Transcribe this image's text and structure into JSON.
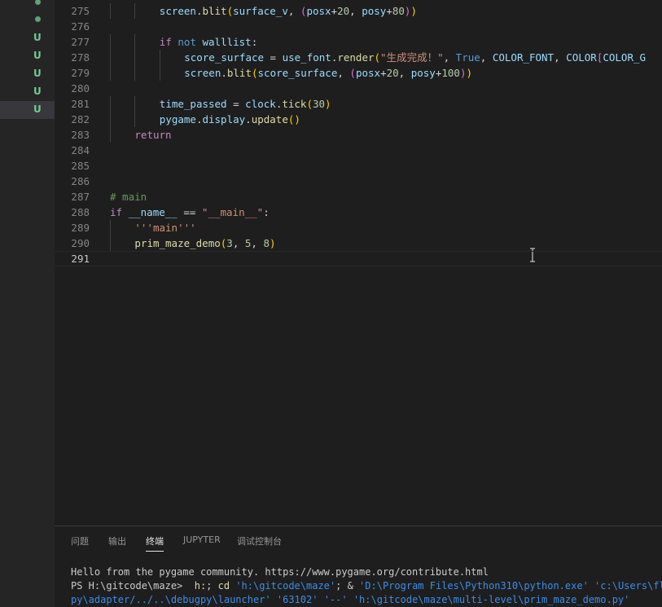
{
  "sidebar": {
    "git_markers": [
      {
        "type": "dot"
      },
      {
        "type": "dot"
      },
      {
        "type": "letter",
        "label": "U"
      },
      {
        "type": "letter",
        "label": "U"
      },
      {
        "type": "letter",
        "label": "U"
      },
      {
        "type": "letter",
        "label": "U"
      },
      {
        "type": "letter",
        "label": "U",
        "selected": true
      }
    ]
  },
  "editor": {
    "lines": [
      {
        "n": "275",
        "indent": 8,
        "tokens": [
          [
            "screen",
            "t-var"
          ],
          [
            ".",
            "t-op"
          ],
          [
            "blit",
            "t-fn"
          ],
          [
            "(",
            "t-br1"
          ],
          [
            "surface_v",
            "t-var"
          ],
          [
            ", ",
            "t-op"
          ],
          [
            "(",
            "t-br2"
          ],
          [
            "posx",
            "t-var"
          ],
          [
            "+",
            "t-op"
          ],
          [
            "20",
            "t-num"
          ],
          [
            ", ",
            "t-op"
          ],
          [
            "posy",
            "t-var"
          ],
          [
            "+",
            "t-op"
          ],
          [
            "80",
            "t-num"
          ],
          [
            ")",
            "t-br2"
          ],
          [
            ")",
            "t-br1"
          ]
        ]
      },
      {
        "n": "276",
        "indent": 0,
        "tokens": []
      },
      {
        "n": "277",
        "indent": 8,
        "tokens": [
          [
            "if",
            "t-kw"
          ],
          [
            " ",
            "t-op"
          ],
          [
            "not",
            "t-kb"
          ],
          [
            " ",
            "t-op"
          ],
          [
            "walllist",
            "t-var"
          ],
          [
            ":",
            "t-op"
          ]
        ]
      },
      {
        "n": "278",
        "indent": 12,
        "tokens": [
          [
            "score_surface",
            "t-var"
          ],
          [
            " = ",
            "t-op"
          ],
          [
            "use_font",
            "t-var"
          ],
          [
            ".",
            "t-op"
          ],
          [
            "render",
            "t-fn"
          ],
          [
            "(",
            "t-br1"
          ],
          [
            "\"生成完成！\"",
            "t-str"
          ],
          [
            ", ",
            "t-op"
          ],
          [
            "True",
            "t-kb"
          ],
          [
            ", ",
            "t-op"
          ],
          [
            "COLOR_FONT",
            "t-var"
          ],
          [
            ", ",
            "t-op"
          ],
          [
            "COLOR",
            "t-var"
          ],
          [
            "[",
            "t-br2"
          ],
          [
            "COLOR_G",
            "t-var"
          ]
        ]
      },
      {
        "n": "279",
        "indent": 12,
        "tokens": [
          [
            "screen",
            "t-var"
          ],
          [
            ".",
            "t-op"
          ],
          [
            "blit",
            "t-fn"
          ],
          [
            "(",
            "t-br1"
          ],
          [
            "score_surface",
            "t-var"
          ],
          [
            ", ",
            "t-op"
          ],
          [
            "(",
            "t-br2"
          ],
          [
            "posx",
            "t-var"
          ],
          [
            "+",
            "t-op"
          ],
          [
            "20",
            "t-num"
          ],
          [
            ", ",
            "t-op"
          ],
          [
            "posy",
            "t-var"
          ],
          [
            "+",
            "t-op"
          ],
          [
            "100",
            "t-num"
          ],
          [
            ")",
            "t-br2"
          ],
          [
            ")",
            "t-br1"
          ]
        ]
      },
      {
        "n": "280",
        "indent": 0,
        "tokens": []
      },
      {
        "n": "281",
        "indent": 8,
        "tokens": [
          [
            "time_passed",
            "t-var"
          ],
          [
            " = ",
            "t-op"
          ],
          [
            "clock",
            "t-var"
          ],
          [
            ".",
            "t-op"
          ],
          [
            "tick",
            "t-fn"
          ],
          [
            "(",
            "t-br1"
          ],
          [
            "30",
            "t-num"
          ],
          [
            ")",
            "t-br1"
          ]
        ]
      },
      {
        "n": "282",
        "indent": 8,
        "tokens": [
          [
            "pygame",
            "t-var"
          ],
          [
            ".",
            "t-op"
          ],
          [
            "display",
            "t-var"
          ],
          [
            ".",
            "t-op"
          ],
          [
            "update",
            "t-fn"
          ],
          [
            "()",
            "t-br1"
          ]
        ]
      },
      {
        "n": "283",
        "indent": 4,
        "tokens": [
          [
            "return",
            "t-kw"
          ]
        ]
      },
      {
        "n": "284",
        "indent": 0,
        "tokens": []
      },
      {
        "n": "285",
        "indent": 0,
        "tokens": []
      },
      {
        "n": "286",
        "indent": 0,
        "tokens": []
      },
      {
        "n": "287",
        "indent": 0,
        "tokens": [
          [
            "# main",
            "t-com"
          ]
        ]
      },
      {
        "n": "288",
        "indent": 0,
        "tokens": [
          [
            "if",
            "t-kw"
          ],
          [
            " ",
            "t-op"
          ],
          [
            "__name__",
            "t-var"
          ],
          [
            " == ",
            "t-op"
          ],
          [
            "\"__main__\"",
            "t-str"
          ],
          [
            ":",
            "t-op"
          ]
        ]
      },
      {
        "n": "289",
        "indent": 4,
        "tokens": [
          [
            "'''main'''",
            "t-str"
          ]
        ]
      },
      {
        "n": "290",
        "indent": 4,
        "tokens": [
          [
            "prim_maze_demo",
            "t-fn"
          ],
          [
            "(",
            "t-br1"
          ],
          [
            "3",
            "t-num"
          ],
          [
            ", ",
            "t-op"
          ],
          [
            "5",
            "t-num"
          ],
          [
            ", ",
            "t-op"
          ],
          [
            "8",
            "t-num"
          ],
          [
            ")",
            "t-br1"
          ]
        ]
      },
      {
        "n": "291",
        "indent": 0,
        "tokens": [],
        "current": true
      }
    ]
  },
  "panel": {
    "tabs": [
      {
        "label": "问题",
        "active": false
      },
      {
        "label": "输出",
        "active": false
      },
      {
        "label": "终端",
        "active": true
      },
      {
        "label": "JUPYTER",
        "active": false
      },
      {
        "label": "调试控制台",
        "active": false
      }
    ],
    "terminal": [
      {
        "segments": [
          [
            "Hello from the pygame community. https://www.pygame.org/contribute.html",
            "term-g"
          ]
        ]
      },
      {
        "segments": [
          [
            "PS H:\\gitcode\\maze>  ",
            "term-g"
          ],
          [
            "h:",
            "term-y"
          ],
          [
            "; ",
            "term-g"
          ],
          [
            "cd",
            "term-y"
          ],
          [
            " ",
            "term-g"
          ],
          [
            "'h:\\gitcode\\maze'",
            "term-b"
          ],
          [
            "; & ",
            "term-g"
          ],
          [
            "'D:\\Program Files\\Python310\\python.exe'",
            "term-b"
          ],
          [
            " ",
            "term-g"
          ],
          [
            "'c:\\Users\\flame",
            "term-b"
          ]
        ]
      },
      {
        "segments": [
          [
            "py\\adapter/../..\\debugpy\\launcher'",
            "term-b"
          ],
          [
            " ",
            "term-g"
          ],
          [
            "'63102'",
            "term-b"
          ],
          [
            " ",
            "term-g"
          ],
          [
            "'--'",
            "term-b"
          ],
          [
            " ",
            "term-g"
          ],
          [
            "'h:\\gitcode\\maze\\multi-level\\prim_maze_demo.py'",
            "term-b"
          ]
        ]
      }
    ]
  }
}
